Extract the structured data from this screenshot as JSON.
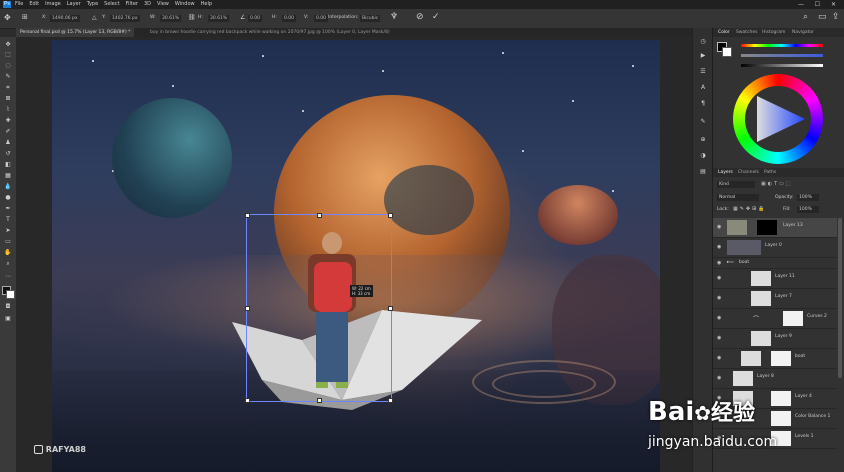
{
  "menubar": {
    "logo": "Ps",
    "items": [
      "File",
      "Edit",
      "Image",
      "Layer",
      "Type",
      "Select",
      "Filter",
      "3D",
      "View",
      "Window",
      "Help"
    ]
  },
  "options": {
    "x_value": "1490.06 px",
    "y_value": "1402.76 px",
    "w_value": "30.61%",
    "h_value": "30.61%",
    "angle_value": "0.00",
    "h_skew": "0.00",
    "v_skew": "0.00",
    "interpolation_label": "Interpolation:",
    "interpolation_value": "Bicubic"
  },
  "doc_tabs": [
    {
      "label": "Personal final.psd @ 15.7% (Layer 13, RGB/8#) *",
      "active": true
    },
    {
      "label": "boy in brown hoodie carrying red backpack while walking on 2070/97.jpg @ 100% (Layer 0, Layer Mask/8)",
      "active": false
    }
  ],
  "canvas": {
    "transform_readout_w": "W: 22 cm",
    "transform_readout_h": "H: 33 cm",
    "watermark_handle": "RAFYA88"
  },
  "color_panel": {
    "tabs": [
      "Color",
      "Swatches",
      "Histogram",
      "Navigator"
    ],
    "accent": "#3b5bdb"
  },
  "layers_panel": {
    "tabs": [
      "Layers",
      "Channels",
      "Paths"
    ],
    "kind_placeholder": "Kind",
    "blend_mode": "Normal",
    "opacity_label": "Opacity:",
    "opacity_value": "100%",
    "lock_label": "Lock:",
    "fill_label": "Fill:",
    "fill_value": "100%",
    "layers": [
      {
        "name": "Layer 13",
        "selected": true,
        "has_mask": true
      },
      {
        "name": "Layer 0",
        "selected": false,
        "has_mask": false
      },
      {
        "name": "boat",
        "selected": false,
        "group": true
      },
      {
        "name": "Layer 11",
        "selected": false,
        "has_mask": false
      },
      {
        "name": "Layer 7",
        "selected": false,
        "has_mask": false
      },
      {
        "name": "Curves 2",
        "selected": false,
        "has_mask": true
      },
      {
        "name": "Layer 9",
        "selected": false,
        "has_mask": false
      },
      {
        "name": "boat",
        "selected": false,
        "has_mask": true
      },
      {
        "name": "Layer 8",
        "selected": false,
        "has_mask": false
      },
      {
        "name": "Layer 4",
        "selected": false,
        "has_mask": true
      },
      {
        "name": "Color Balance 1",
        "selected": false,
        "has_mask": true
      },
      {
        "name": "Levels 1",
        "selected": false,
        "has_mask": true
      }
    ]
  },
  "watermark": {
    "brand": "Bai",
    "brand2": "经验",
    "url": "jingyan.baidu.com"
  }
}
